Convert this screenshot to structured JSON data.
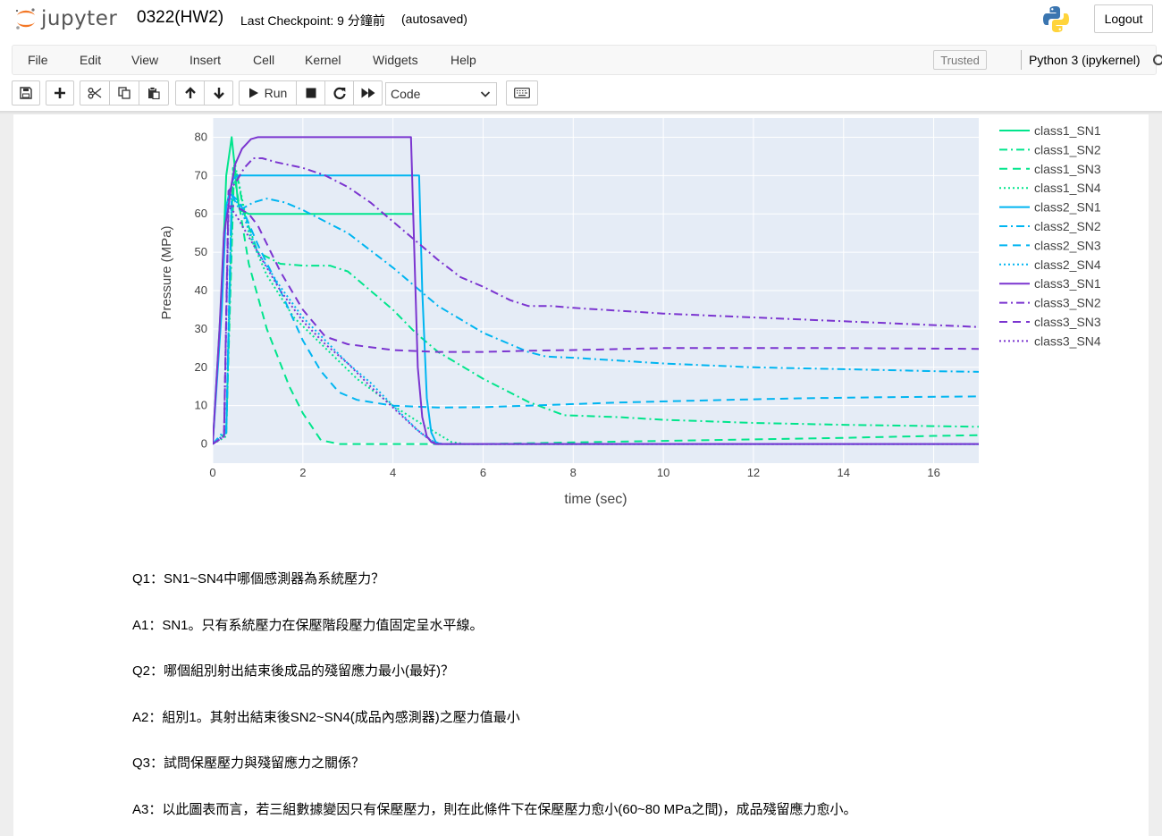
{
  "header": {
    "logo_text": "jupyter",
    "notebook_name": "0322(HW2)",
    "checkpoint": "Last Checkpoint: 9 分鐘前",
    "autosave": "(autosaved)",
    "logout_label": "Logout"
  },
  "menubar": {
    "items": [
      "File",
      "Edit",
      "View",
      "Insert",
      "Cell",
      "Kernel",
      "Widgets",
      "Help"
    ],
    "trusted_label": "Trusted",
    "kernel_name": "Python 3 (ipykernel)"
  },
  "toolbar": {
    "run_label": "Run",
    "cell_type": "Code",
    "icons": [
      "save-icon",
      "plus-icon",
      "cut-icon",
      "copy-icon",
      "paste-icon",
      "arrow-up-icon",
      "arrow-down-icon",
      "run-icon",
      "stop-icon",
      "restart-icon",
      "fast-forward-icon",
      "keyboard-icon"
    ]
  },
  "chart_data": {
    "type": "line",
    "title": "",
    "xlabel": "time (sec)",
    "ylabel": "Pressure (MPa)",
    "xlim": [
      0,
      17
    ],
    "ylim": [
      -5,
      85
    ],
    "xticks": [
      0,
      2,
      4,
      6,
      8,
      10,
      12,
      14,
      16
    ],
    "yticks": [
      0,
      10,
      20,
      30,
      40,
      50,
      60,
      70,
      80
    ],
    "legend_position": "right",
    "grid": true,
    "series": [
      {
        "name": "class1_SN1",
        "color": "#00e58c",
        "dash": "solid",
        "x": [
          0,
          0.2,
          0.3,
          0.42,
          0.5,
          0.55,
          0.6,
          0.8,
          1.0,
          4.4,
          4.45
        ],
        "y": [
          0,
          40,
          70,
          80,
          71,
          64,
          61,
          60,
          60,
          60,
          60
        ]
      },
      {
        "name": "class1_SN2",
        "color": "#00e58c",
        "dash": "dashdot",
        "x": [
          0,
          0.3,
          0.48,
          0.7,
          1.0,
          1.5,
          2.0,
          2.6,
          3.0,
          3.5,
          4.0,
          4.5,
          5.0,
          6.0,
          7.0,
          7.8,
          9,
          10,
          12,
          14,
          17
        ],
        "y": [
          0,
          3,
          74,
          60,
          50,
          47,
          46.5,
          46.5,
          45,
          40,
          35,
          29,
          24,
          17,
          11,
          7.5,
          7,
          6.3,
          5.5,
          5,
          4.5
        ]
      },
      {
        "name": "class1_SN3",
        "color": "#00e58c",
        "dash": "dash",
        "x": [
          0,
          0.3,
          0.45,
          0.55,
          0.8,
          1.2,
          1.7,
          2.0,
          2.4,
          2.8,
          3.0,
          4.0,
          6.0,
          8.0,
          10.0,
          12.0,
          14.0,
          16.0,
          17.0
        ],
        "y": [
          0,
          3,
          72,
          65,
          47,
          30,
          15,
          8,
          1,
          0,
          0,
          0,
          0,
          0.4,
          0.8,
          1.2,
          1.6,
          2.1,
          2.3
        ]
      },
      {
        "name": "class1_SN4",
        "color": "#00e58c",
        "dash": "dot",
        "x": [
          0,
          0.3,
          0.45,
          0.55,
          0.8,
          1.2,
          1.8,
          2.5,
          3.2,
          4.0,
          4.8,
          5.3,
          5.6,
          17.0
        ],
        "y": [
          0,
          2,
          72,
          70,
          55,
          44,
          33,
          25,
          17,
          10,
          4,
          0.5,
          0,
          0
        ]
      },
      {
        "name": "class2_SN1",
        "color": "#00b5f1",
        "dash": "solid",
        "x": [
          0,
          0.2,
          0.3,
          0.38,
          0.45,
          0.55,
          0.8,
          4.58,
          4.65,
          4.75,
          4.85,
          4.95,
          5.05,
          17.0
        ],
        "y": [
          0,
          35,
          62,
          66,
          69,
          70,
          70,
          70,
          40,
          12,
          3,
          0.5,
          0,
          0
        ]
      },
      {
        "name": "class2_SN2",
        "color": "#00b5f1",
        "dash": "dashdot",
        "x": [
          0,
          0.3,
          0.42,
          0.6,
          0.9,
          1.2,
          1.6,
          2.0,
          3.0,
          4.0,
          5.0,
          6.0,
          7.0,
          7.4,
          8.0,
          10.0,
          12.0,
          14.0,
          16.0,
          17.0
        ],
        "y": [
          0,
          4,
          65,
          61,
          63,
          64,
          63,
          61,
          55,
          46,
          36,
          29,
          24,
          22.8,
          22.5,
          21,
          20,
          19.5,
          19,
          18.8
        ]
      },
      {
        "name": "class2_SN3",
        "color": "#00b5f1",
        "dash": "dash",
        "x": [
          0,
          0.3,
          0.42,
          0.6,
          1.0,
          1.5,
          2.0,
          2.4,
          2.8,
          3.2,
          4.0,
          5.0,
          6.0,
          7.0,
          9.0,
          11.0,
          13.0,
          15.0,
          17.0
        ],
        "y": [
          0,
          3,
          65,
          63,
          52,
          40,
          27,
          19,
          13.5,
          11.5,
          10,
          9.5,
          9.6,
          10.0,
          10.8,
          11.4,
          11.9,
          12.2,
          12.4
        ]
      },
      {
        "name": "class2_SN4",
        "color": "#00b5f1",
        "dash": "dot",
        "x": [
          0,
          0.3,
          0.42,
          0.6,
          1.0,
          1.5,
          2.0,
          2.5,
          3.0,
          3.5,
          4.0,
          4.6,
          4.9,
          5.1,
          17.0
        ],
        "y": [
          0,
          3,
          65,
          62,
          50,
          41,
          33,
          27,
          21,
          16,
          10,
          3,
          0.6,
          0,
          0
        ]
      },
      {
        "name": "class3_SN1",
        "color": "#7b35d0",
        "dash": "solid",
        "x": [
          0,
          0.15,
          0.25,
          0.35,
          0.42,
          0.5,
          0.65,
          0.85,
          1.0,
          1.5,
          4.4,
          4.48,
          4.55,
          4.65,
          4.75,
          4.85,
          4.95,
          17.0
        ],
        "y": [
          0,
          30,
          55,
          62,
          68,
          73,
          77,
          79.5,
          80,
          80,
          80,
          48,
          20,
          7,
          2,
          0.5,
          0,
          0
        ]
      },
      {
        "name": "class3_SN2",
        "color": "#7b35d0",
        "dash": "dashdot",
        "x": [
          0,
          0.25,
          0.35,
          0.5,
          0.7,
          0.9,
          1.1,
          1.4,
          2.0,
          2.5,
          3.0,
          3.5,
          4.0,
          4.5,
          5.0,
          5.5,
          6.0,
          6.6,
          7.0,
          7.5,
          8.0,
          10.0,
          12.0,
          14.0,
          17.0
        ],
        "y": [
          0,
          2,
          66,
          68,
          72,
          74.5,
          74.5,
          73.5,
          72,
          70,
          67,
          63,
          58,
          53,
          48,
          43.5,
          41,
          37.5,
          36,
          36,
          35.5,
          34,
          33,
          32,
          30.5
        ]
      },
      {
        "name": "class3_SN3",
        "color": "#7b35d0",
        "dash": "dash",
        "x": [
          0,
          0.25,
          0.35,
          0.5,
          0.8,
          1.0,
          1.5,
          2.0,
          2.5,
          3.0,
          4.0,
          5.0,
          6.0,
          7.0,
          8.0,
          10.0,
          12.0,
          14.0,
          17.0
        ],
        "y": [
          0,
          2,
          62,
          62,
          60,
          57,
          45,
          35,
          28,
          26,
          24.5,
          24,
          24,
          24.3,
          24.5,
          25,
          25,
          25,
          24.8
        ]
      },
      {
        "name": "class3_SN4",
        "color": "#7b35d0",
        "dash": "dot",
        "x": [
          0,
          0.25,
          0.35,
          0.5,
          1.0,
          1.5,
          2.0,
          2.5,
          3.0,
          3.5,
          4.0,
          4.5,
          4.85,
          5.0,
          17.0
        ],
        "y": [
          0,
          2,
          62,
          60,
          50,
          40,
          32,
          26,
          21,
          15,
          9.5,
          4,
          0.8,
          0,
          0
        ]
      }
    ]
  },
  "markdown": {
    "q1": "Q1：SN1~SN4中哪個感測器為系統壓力？",
    "a1": "A1：SN1。只有系統壓力在保壓階段壓力值固定呈水平線。",
    "q2": "Q2：哪個組別射出結束後成品的殘留應力最小(最好)？",
    "a2": "A2：組別1。其射出結束後SN2~SN4(成品內感測器)之壓力值最小",
    "q3": "Q3：試問保壓壓力與殘留應力之關係？",
    "a3": "A3：以此圖表而言，若三組數據變因只有保壓壓力，則在此條件下在保壓壓力愈小(60~80 MPa之間)，成品殘留應力愈小。"
  }
}
